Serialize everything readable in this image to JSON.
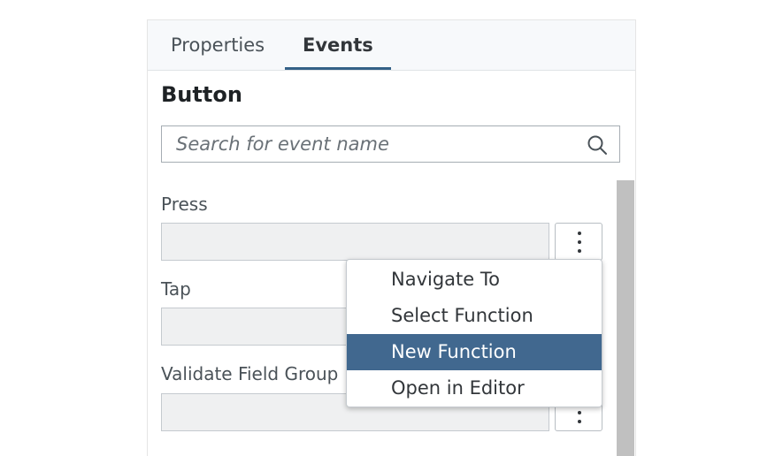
{
  "tabs": [
    {
      "label": "Properties",
      "active": false
    },
    {
      "label": "Events",
      "active": true
    }
  ],
  "section_title": "Button",
  "search": {
    "placeholder": "Search for event name",
    "value": "",
    "icon": "search-icon"
  },
  "events": [
    {
      "label": "Press",
      "value": ""
    },
    {
      "label": "Tap",
      "value": ""
    },
    {
      "label": "Validate Field Group",
      "value": ""
    }
  ],
  "context_menu": {
    "items": [
      {
        "label": "Navigate To"
      },
      {
        "label": "Select Function"
      },
      {
        "label": "New Function",
        "highlighted": true
      },
      {
        "label": "Open in Editor"
      }
    ]
  },
  "colors": {
    "accent": "#346187",
    "menu_highlight": "#41688f",
    "tabbar_bg": "#f7f9fb",
    "field_bg": "#eff0f1",
    "scrollbar": "#c0c0c0"
  }
}
